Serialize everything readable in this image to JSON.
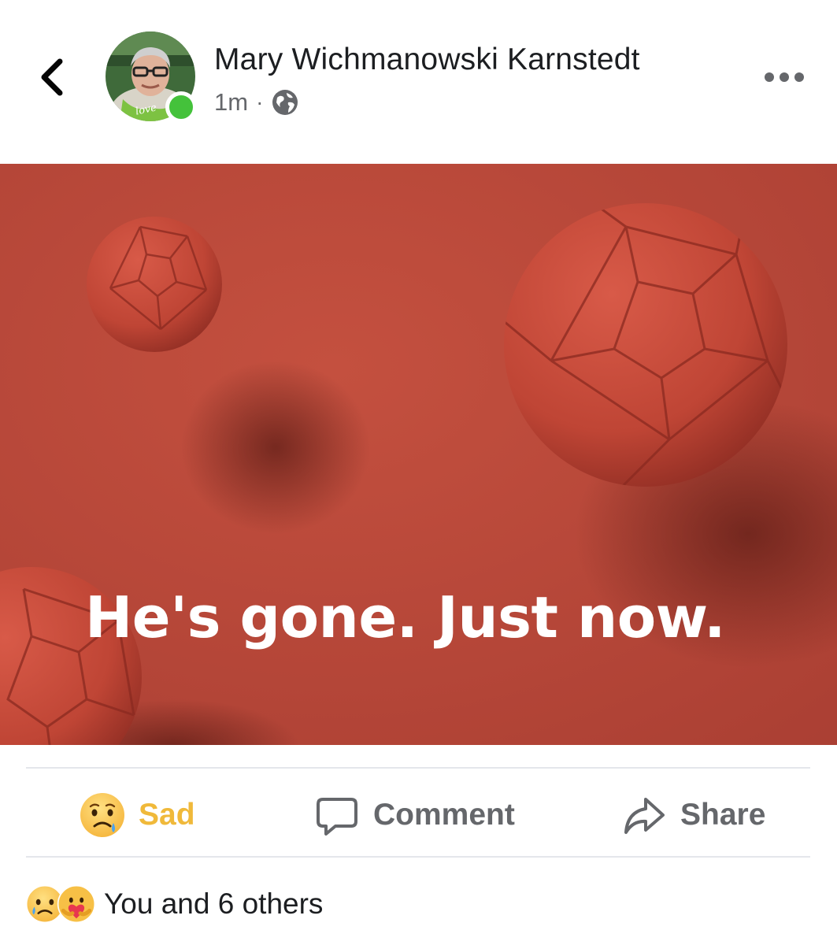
{
  "post": {
    "author_name": "Mary Wichmanowski Karnstedt",
    "time": "1m",
    "separator": "·",
    "privacy_icon": "globe-icon",
    "headline": "He's gone. Just now.",
    "avatar_badge_text": "love"
  },
  "actions": {
    "sad_label": "Sad",
    "comment_label": "Comment",
    "share_label": "Share"
  },
  "reactions": {
    "summary": "You and 6 others",
    "icons": [
      "sad-reaction-icon",
      "care-reaction-icon"
    ]
  },
  "colors": {
    "image_background": "#b8473a",
    "sad_accent": "#f0b93a",
    "online_green": "#44c23b",
    "secondary_text": "#65676b"
  }
}
